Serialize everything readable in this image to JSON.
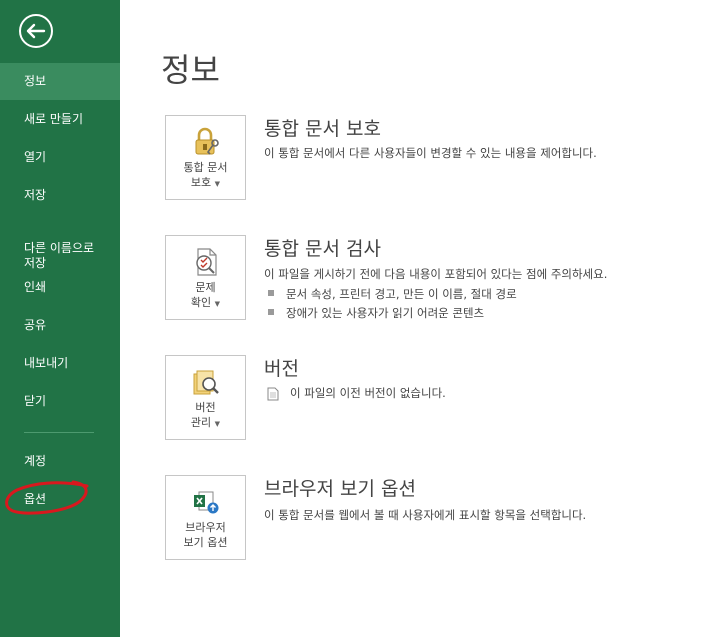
{
  "sidebar": {
    "items": [
      {
        "label": "정보"
      },
      {
        "label": "새로 만들기"
      },
      {
        "label": "열기"
      },
      {
        "label": "저장"
      },
      {
        "label": "다른 이름으로\n저장"
      },
      {
        "label": "인쇄"
      },
      {
        "label": "공유"
      },
      {
        "label": "내보내기"
      },
      {
        "label": "닫기"
      },
      {
        "label": "계정"
      },
      {
        "label": "옵션"
      }
    ],
    "active_item": "정보",
    "highlighted_item": "옵션"
  },
  "page": {
    "title": "정보"
  },
  "sections": [
    {
      "button_line1": "통합 문서",
      "button_line2": "보호",
      "heading": "통합 문서 보호",
      "description": "이 통합 문서에서 다른 사용자들이 변경할 수 있는 내용을 제어합니다.",
      "icon": "lock-key-icon"
    },
    {
      "button_line1": "문제",
      "button_line2": "확인",
      "heading": "통합 문서 검사",
      "description": "이 파일을 게시하기 전에 다음 내용이 포함되어 있다는 점에 주의하세요.",
      "bullets": [
        "문서 속성, 프린터 경고, 만든 이 이름, 절대 경로",
        "장애가 있는 사용자가 읽기 어려운 콘텐츠"
      ],
      "icon": "inspect-document-icon"
    },
    {
      "button_line1": "버전",
      "button_line2": "관리",
      "heading": "버전",
      "description": "이 파일의 이전 버전이 없습니다.",
      "icon": "version-search-icon"
    },
    {
      "button_line1": "브라우저",
      "button_line2": "보기 옵션",
      "heading": "브라우저 보기 옵션",
      "description": "이 통합 문서를 웹에서 볼 때 사용자에게 표시할 항목을 선택합니다.",
      "icon": "excel-browser-icon"
    }
  ],
  "colors": {
    "sidebar": "#217346",
    "sidebar_active": "#3a8c5f",
    "annotation": "#d9181e"
  }
}
